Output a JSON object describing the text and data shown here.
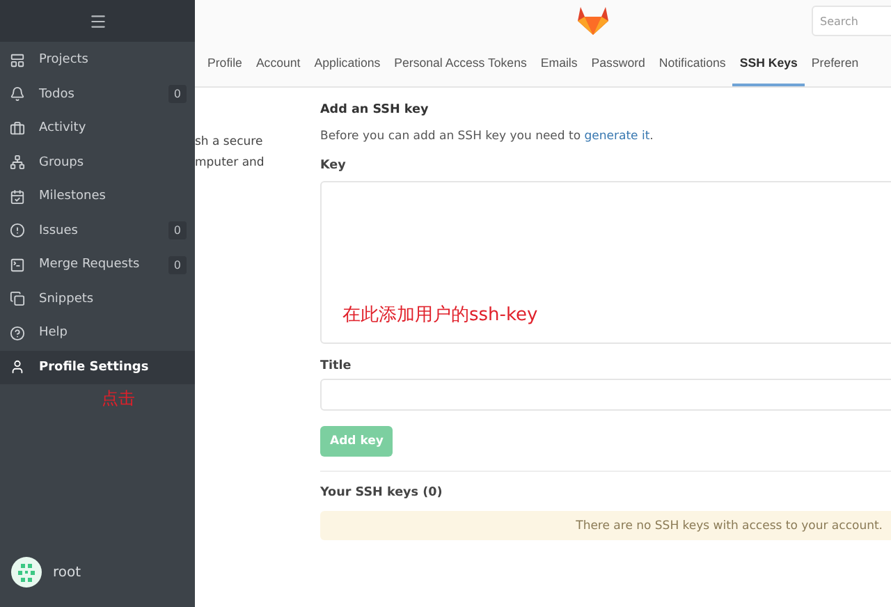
{
  "sidebar": {
    "items": [
      {
        "label": "Projects",
        "selected": false
      },
      {
        "label": "Todos",
        "count": "0",
        "selected": false
      },
      {
        "label": "Activity",
        "selected": false
      },
      {
        "label": "Groups",
        "selected": false
      },
      {
        "label": "Milestones",
        "selected": false
      },
      {
        "label": "Issues",
        "count": "0",
        "selected": false
      },
      {
        "label": "Merge Requests",
        "count": "0",
        "selected": false
      },
      {
        "label": "Snippets",
        "selected": false
      },
      {
        "label": "Help",
        "selected": false
      },
      {
        "label": "Profile Settings",
        "selected": true
      }
    ],
    "annotation": "点击",
    "user": "root"
  },
  "header": {
    "search": {
      "placeholder": "Search"
    }
  },
  "tabs": [
    {
      "label": "Profile",
      "selected": false
    },
    {
      "label": "Account",
      "selected": false
    },
    {
      "label": "Applications",
      "selected": false
    },
    {
      "label": "Personal Access Tokens",
      "selected": false
    },
    {
      "label": "Emails",
      "selected": false
    },
    {
      "label": "Password",
      "selected": false
    },
    {
      "label": "Notifications",
      "selected": false
    },
    {
      "label": "SSH Keys",
      "selected": true
    },
    {
      "label": "Preferen",
      "selected": false
    }
  ],
  "description_lines": [
    "sh a secure",
    "mputer and"
  ],
  "form": {
    "heading": "Add an SSH key",
    "intro": "Before you can add an SSH key you need to ",
    "intro_link": "generate it",
    "intro_end": ".",
    "key_label": "Key",
    "key_annotation": "在此添加用户的ssh-key",
    "title_label": "Title",
    "button": "Add key"
  },
  "keys": {
    "heading": "Your SSH keys (0)",
    "empty_message": "There are no SSH keys with access to your account."
  }
}
